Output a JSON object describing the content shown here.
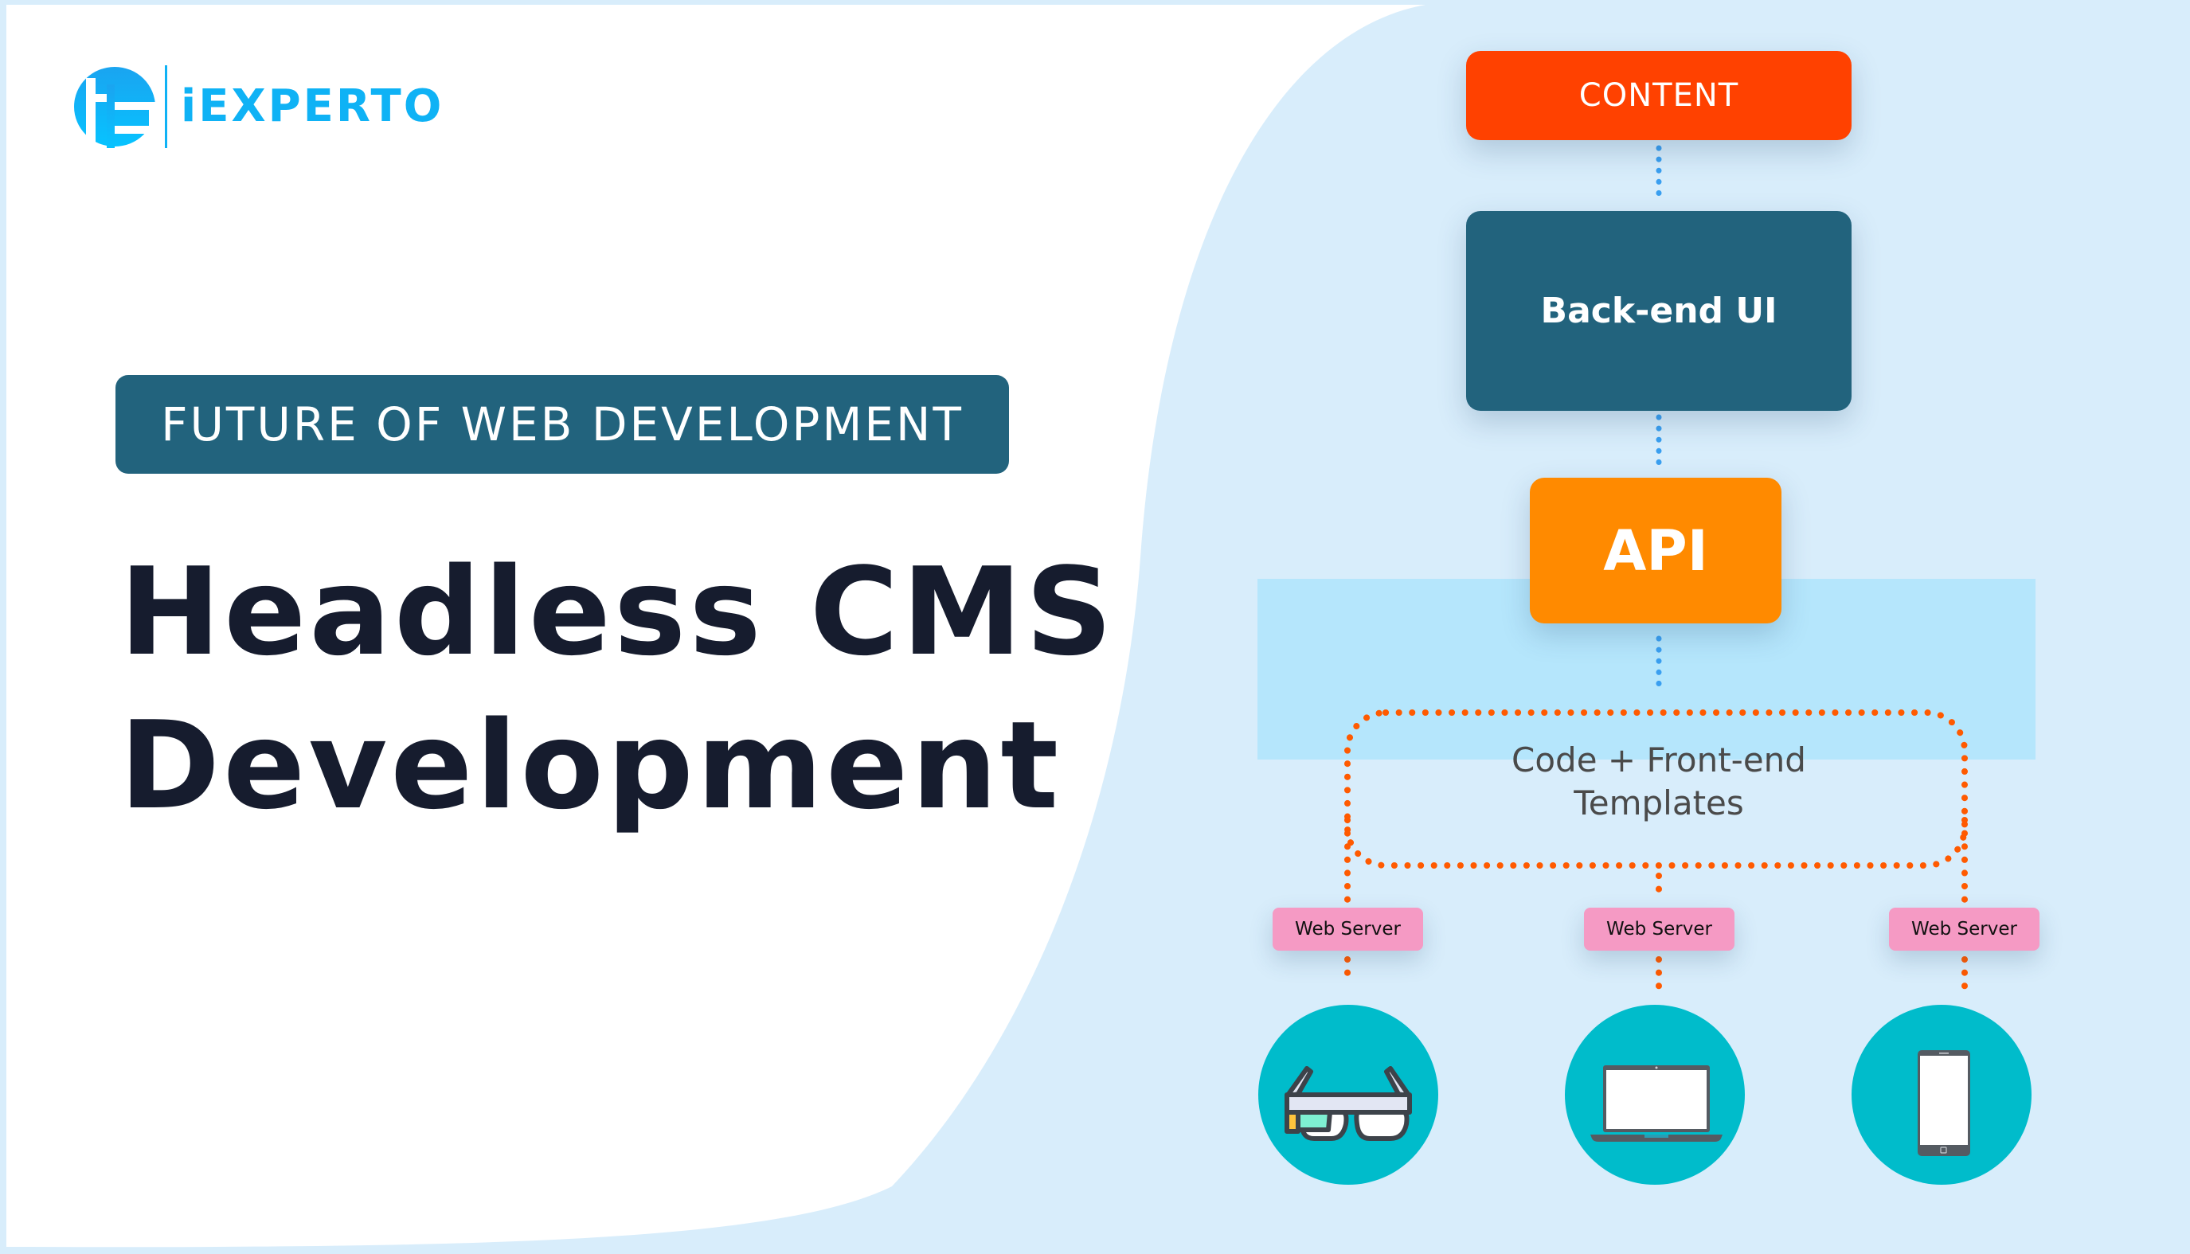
{
  "brand": {
    "name": "iEXPERTO",
    "icon": "iexperto-logo-icon",
    "color": "#0fb2f5"
  },
  "hero": {
    "tagline": "FUTURE OF WEB DEVELOPMENT",
    "title_line1": "Headless CMS",
    "title_line2": "Development"
  },
  "diagram": {
    "nodes": {
      "content": "CONTENT",
      "backend": "Back-end UI",
      "api": "API",
      "templates_line1": "Code + Front-end",
      "templates_line2": "Templates"
    },
    "web_servers": [
      {
        "label": "Web Server",
        "device": "smart-glasses"
      },
      {
        "label": "Web Server",
        "device": "laptop"
      },
      {
        "label": "Web Server",
        "device": "smartphone"
      }
    ],
    "colors": {
      "content": "#ff4100",
      "backend": "#22637d",
      "api": "#ff8a00",
      "web_server": "#f59ac4",
      "device_circle": "#00bccb",
      "connector_blue": "#3a9ff0",
      "connector_orange": "#ff5a00",
      "background": "#d8edfb",
      "band": "#b5e6fc"
    },
    "edges": [
      {
        "from": "content",
        "to": "backend",
        "style": "dotted-blue"
      },
      {
        "from": "backend",
        "to": "api",
        "style": "dotted-blue"
      },
      {
        "from": "api",
        "to": "templates",
        "style": "dotted-blue"
      },
      {
        "from": "templates",
        "to": "web_server_1",
        "style": "dotted-orange"
      },
      {
        "from": "templates",
        "to": "web_server_2",
        "style": "dotted-orange"
      },
      {
        "from": "templates",
        "to": "web_server_3",
        "style": "dotted-orange"
      },
      {
        "from": "web_server_1",
        "to": "smart-glasses",
        "style": "dotted-orange"
      },
      {
        "from": "web_server_2",
        "to": "laptop",
        "style": "dotted-orange"
      },
      {
        "from": "web_server_3",
        "to": "smartphone",
        "style": "dotted-orange"
      }
    ]
  }
}
